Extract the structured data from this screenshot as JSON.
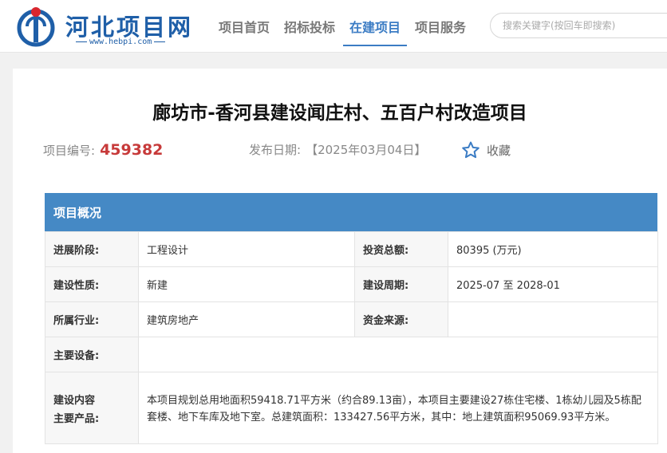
{
  "site": {
    "name": "河北项目网",
    "url": "www.hebpi.com"
  },
  "nav": {
    "items": [
      {
        "label": "项目首页"
      },
      {
        "label": "招标投标"
      },
      {
        "label": "在建项目"
      },
      {
        "label": "项目服务"
      }
    ],
    "active": "在建项目"
  },
  "search": {
    "placeholder": "搜索关键字(按回车即搜索)"
  },
  "project": {
    "title": "廊坊市-香河县建设闻庄村、五百户村改造项目",
    "id_label": "项目编号:",
    "id": "459382",
    "date_label": "发布日期:",
    "date": "【2025年03月04日】",
    "favorite_label": "收藏"
  },
  "overview": {
    "heading": "项目概况",
    "stage_label": "进展阶段:",
    "stage": "工程设计",
    "investment_label": "投资总额:",
    "investment": "80395 (万元)",
    "nature_label": "建设性质:",
    "nature": "新建",
    "period_label": "建设周期:",
    "period": "2025-07 至 2028-01",
    "industry_label": "所属行业:",
    "industry": "建筑房地产",
    "funding_label": "资金来源:",
    "funding": "",
    "equipment_label": "主要设备:",
    "equipment": "",
    "content_label_1": "建设内容",
    "content_label_2": "主要产品:",
    "content": "本项目规划总用地面积59418.71平方米（约合89.13亩），本项目主要建设27栋住宅楼、1栋幼儿园及5栋配套楼、地下车库及地下室。总建筑面积：133427.56平方米，其中：地上建筑面积95069.93平方米。"
  },
  "colors": {
    "brand": "#1f5fa8",
    "accent": "#3b7cc4",
    "panel_header": "#4589c5",
    "id_red": "#c73a3a",
    "logo_red": "#d9262e"
  },
  "icons": {
    "logo": "hebpi-logo-icon",
    "favorite": "star-outline-icon"
  }
}
